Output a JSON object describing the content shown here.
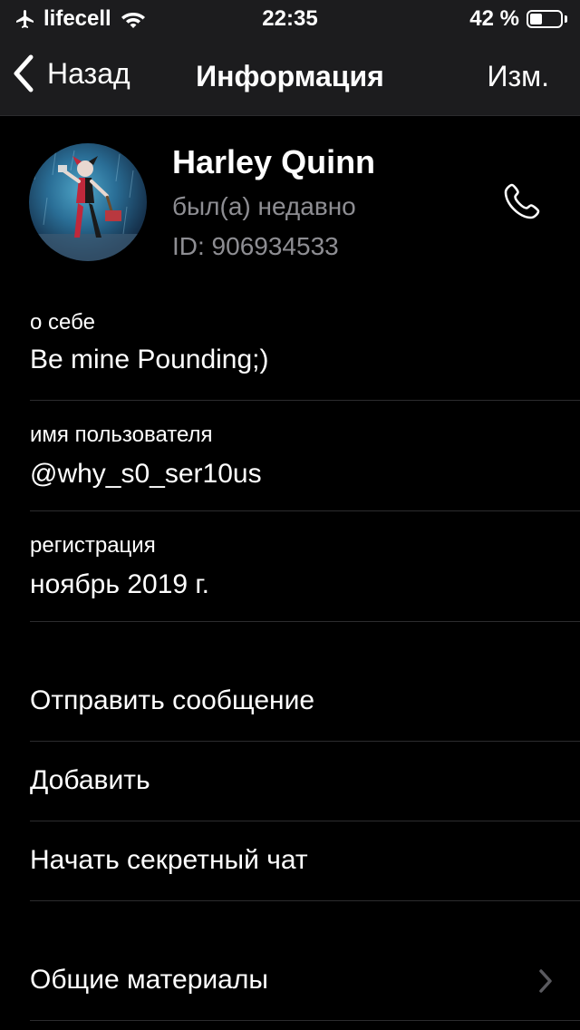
{
  "status_bar": {
    "carrier": "lifecell",
    "time": "22:35",
    "battery_percent": "42 %",
    "battery_level": 0.42,
    "icons": [
      "airplane-icon",
      "wifi-icon",
      "battery-icon"
    ]
  },
  "nav": {
    "back_label": "Назад",
    "title": "Информация",
    "edit_label": "Изм."
  },
  "profile": {
    "name": "Harley Quinn",
    "status": "был(а) недавно",
    "id_text": "ID: 906934533",
    "call_icon": "phone-icon"
  },
  "info": {
    "about": {
      "label": "о себе",
      "value": "Be mine Pounding;)"
    },
    "username": {
      "label": "имя пользователя",
      "value": "@why_s0_ser10us"
    },
    "registration": {
      "label": "регистрация",
      "value": "ноябрь 2019 г."
    }
  },
  "actions": {
    "send_message": "Отправить сообщение",
    "add": "Добавить",
    "secret_chat": "Начать секретный чат",
    "shared_media": "Общие материалы"
  },
  "colors": {
    "background": "#000000",
    "bar_background": "#1c1c1e",
    "secondary_text": "#8e8e93",
    "separator": "#2c2c2e",
    "chevron": "#5a5a5f"
  }
}
